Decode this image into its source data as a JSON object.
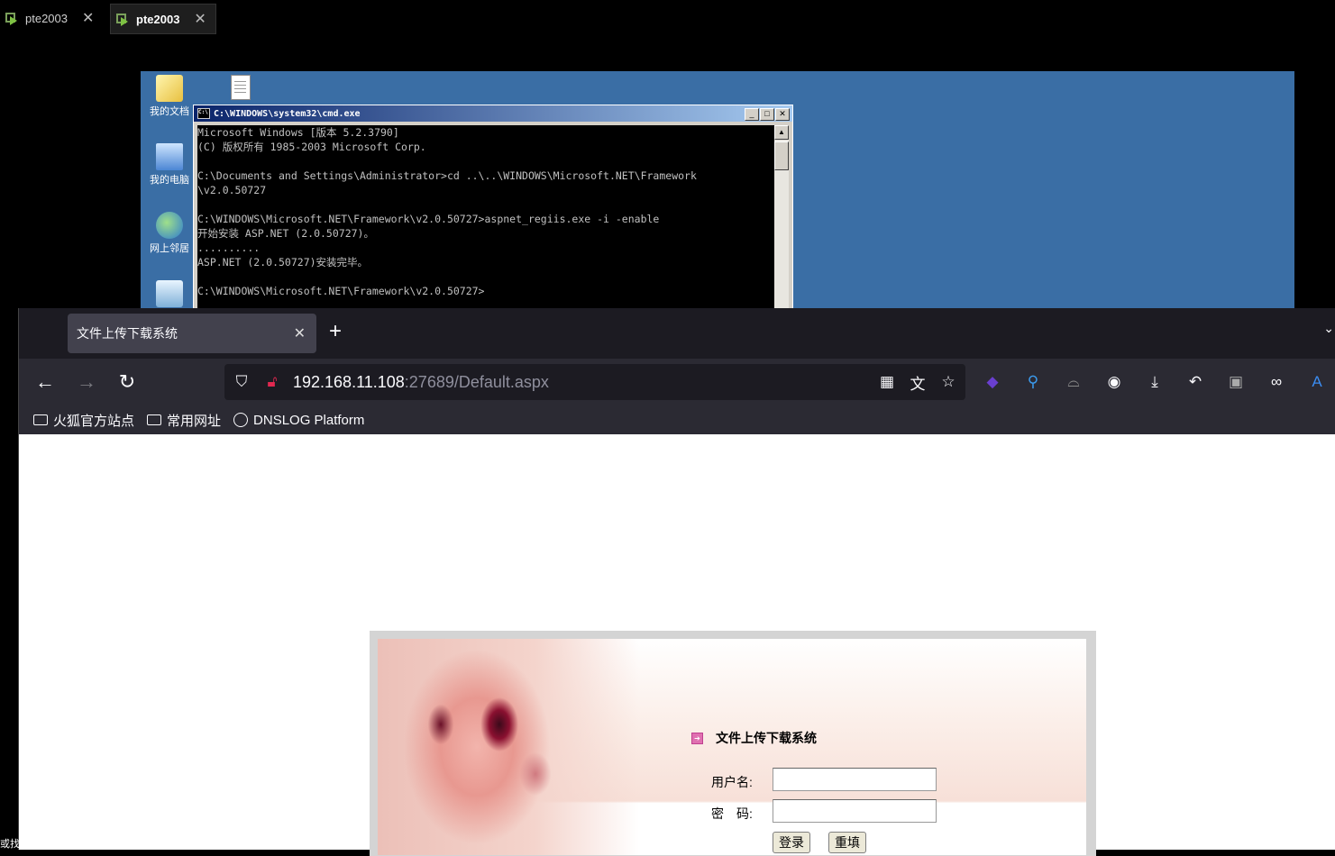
{
  "vm_tabs": [
    {
      "label": "pte2003",
      "active": false
    },
    {
      "label": "pte2003",
      "active": true
    }
  ],
  "desktop": {
    "icons": [
      "我的文档",
      "我的电脑",
      "网上邻居",
      ""
    ],
    "cmd": {
      "title": "C:\\WINDOWS\\system32\\cmd.exe",
      "lines": [
        "Microsoft Windows [版本 5.2.3790]",
        "(C) 版权所有 1985-2003 Microsoft Corp.",
        "",
        "C:\\Documents and Settings\\Administrator>cd ..\\..\\WINDOWS\\Microsoft.NET\\Framework",
        "\\v2.0.50727",
        "",
        "C:\\WINDOWS\\Microsoft.NET\\Framework\\v2.0.50727>aspnet_regiis.exe -i -enable",
        "开始安装 ASP.NET (2.0.50727)。",
        "..........",
        "ASP.NET (2.0.50727)安装完毕。",
        "",
        "C:\\WINDOWS\\Microsoft.NET\\Framework\\v2.0.50727>"
      ]
    }
  },
  "browser": {
    "tab_title": "文件上传下载系统",
    "url_host": "192.168.11.108",
    "url_rest": ":27689/Default.aspx",
    "bookmarks": [
      "火狐官方站点",
      "常用网址",
      "DNSLOG Platform"
    ]
  },
  "login": {
    "title": "文件上传下载系统",
    "username_label": "用户名:",
    "password_label": "密　码:",
    "login_button": "登录",
    "reset_button": "重填"
  },
  "left_edge_text": "或找"
}
